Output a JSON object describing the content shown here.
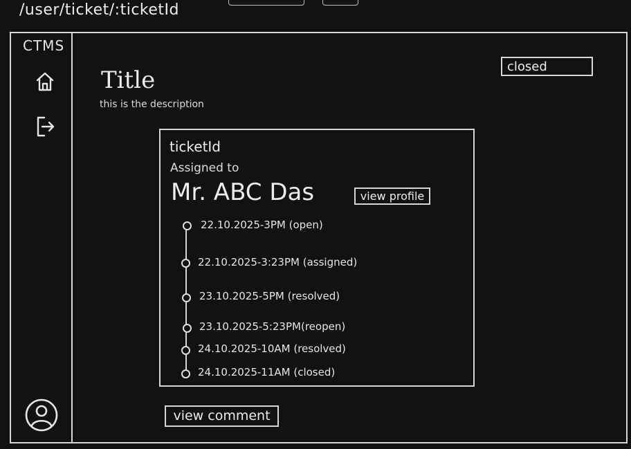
{
  "page": {
    "route": "/user/ticket/:ticketId"
  },
  "sidebar": {
    "brand": "CTMS",
    "icons": [
      "home-icon",
      "logout-icon",
      "profile-avatar-icon"
    ]
  },
  "ticket": {
    "title": "Title",
    "description": "this is the description",
    "status": "closed",
    "id_label": "ticketId",
    "assigned_label": "Assigned to",
    "assignee": "Mr. ABC Das",
    "view_profile_label": "view profile"
  },
  "timeline": [
    {
      "text": "22.10.2025-3PM (open)"
    },
    {
      "text": "22.10.2025-3:23PM  (assigned)"
    },
    {
      "text": "23.10.2025-5PM (resolved)"
    },
    {
      "text": "23.10.2025-5:23PM(reopen)"
    },
    {
      "text": "24.10.2025-10AM    (resolved)"
    },
    {
      "text": "24.10.2025-11AM    (closed)"
    }
  ],
  "actions": {
    "view_comment_label": "view comment"
  },
  "colors": {
    "background": "#121212",
    "stroke": "#d8d8d8",
    "text": "#e6e6e6"
  }
}
